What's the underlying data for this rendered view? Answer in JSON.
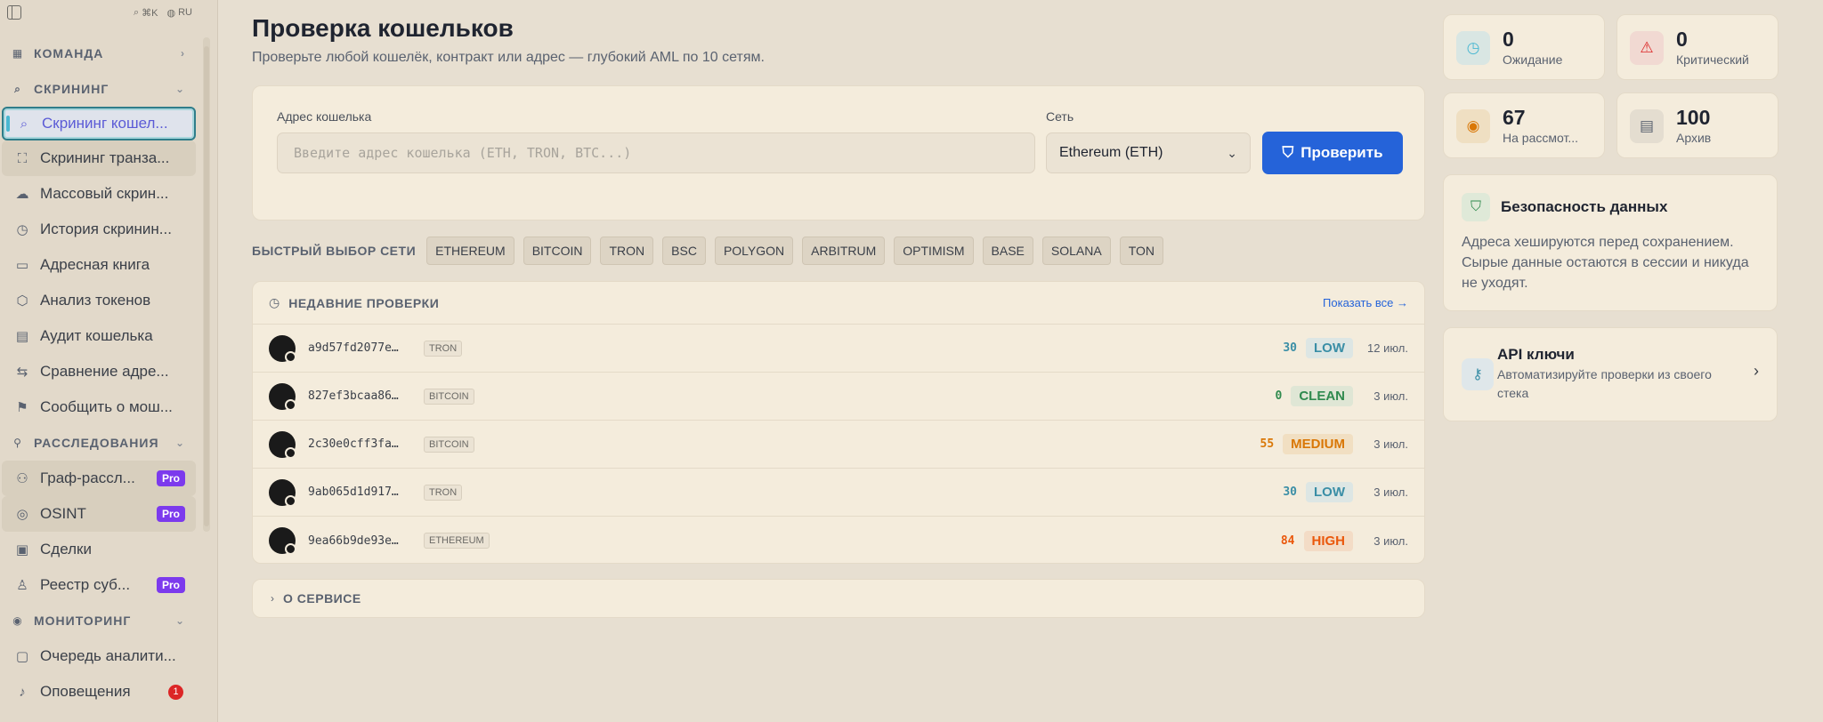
{
  "sidebar": {
    "top_tools": {
      "search": "⌘K",
      "lang": "RU"
    },
    "sections": {
      "team": "КОМАНДА",
      "screening": "СКРИНИНГ",
      "investigations": "РАССЛЕДОВАНИЯ",
      "monitoring": "МОНИТОРИНГ"
    },
    "items": [
      {
        "label": "Скрининг кошел..."
      },
      {
        "label": "Скрининг транза..."
      },
      {
        "label": "Массовый скрин..."
      },
      {
        "label": "История скринин..."
      },
      {
        "label": "Адресная книга"
      },
      {
        "label": "Анализ токенов"
      },
      {
        "label": "Аудит кошелька"
      },
      {
        "label": "Сравнение адре..."
      },
      {
        "label": "Сообщить о мош..."
      },
      {
        "label": "Граф-рассл...",
        "badge": "Pro"
      },
      {
        "label": "OSINT",
        "badge": "Pro"
      },
      {
        "label": "Сделки"
      },
      {
        "label": "Реестр суб...",
        "badge": "Pro"
      },
      {
        "label": "Очередь аналити..."
      },
      {
        "label": "Оповещения",
        "count": "1"
      }
    ]
  },
  "main": {
    "title": "Проверка кошельков",
    "subtitle": "Проверьте любой кошелёк, контракт или адрес — глубокий AML по 10 сетям.",
    "address_label": "Адрес кошелька",
    "address_placeholder": "Введите адрес кошелька (ETH, TRON, BTC...)",
    "network_label": "Сеть",
    "network_value": "Ethereum (ETH)",
    "check_button": "Проверить",
    "quick_label": "БЫСТРЫЙ ВЫБОР СЕТИ",
    "quick_chips": [
      "ETHEREUM",
      "BITCOIN",
      "TRON",
      "BSC",
      "POLYGON",
      "ARBITRUM",
      "OPTIMISM",
      "BASE",
      "SOLANA",
      "TON"
    ],
    "recent_title": "НЕДАВНИЕ ПРОВЕРКИ",
    "show_all": "Показать все →",
    "recent": [
      {
        "address": "a9d57fd2077e…",
        "network": "TRON",
        "score": "30",
        "risk": "LOW",
        "date": "12 июл."
      },
      {
        "address": "827ef3bcaa86…",
        "network": "BITCOIN",
        "score": "0",
        "risk": "CLEAN",
        "date": "3 июл."
      },
      {
        "address": "2c30e0cff3fa…",
        "network": "BITCOIN",
        "score": "55",
        "risk": "MEDIUM",
        "date": "3 июл."
      },
      {
        "address": "9ab065d1d917…",
        "network": "TRON",
        "score": "30",
        "risk": "LOW",
        "date": "3 июл."
      },
      {
        "address": "9ea66b9de93e…",
        "network": "ETHEREUM",
        "score": "84",
        "risk": "HIGH",
        "date": "3 июл."
      }
    ],
    "about": "О СЕРВИСЕ"
  },
  "stats": [
    {
      "value": "0",
      "label": "Ожидание",
      "icon": "clock-icon"
    },
    {
      "value": "0",
      "label": "Критический",
      "icon": "alert-icon"
    },
    {
      "value": "67",
      "label": "На рассмот...",
      "icon": "eye-icon"
    },
    {
      "value": "100",
      "label": "Архив",
      "icon": "archive-icon"
    }
  ],
  "security": {
    "title": "Безопасность данных",
    "text": "Адреса хешируются перед сохранением. Сырые данные остаются в сессии и никуда не уходят."
  },
  "api": {
    "title": "API ключи",
    "text": "Автоматизируйте проверки из своего стека"
  },
  "colors": {
    "accent": "#2563d9",
    "pro": "#7c3aed",
    "low": "#3a8ea6",
    "clean": "#2f8a4e",
    "medium": "#d97706",
    "high": "#ea580c"
  }
}
